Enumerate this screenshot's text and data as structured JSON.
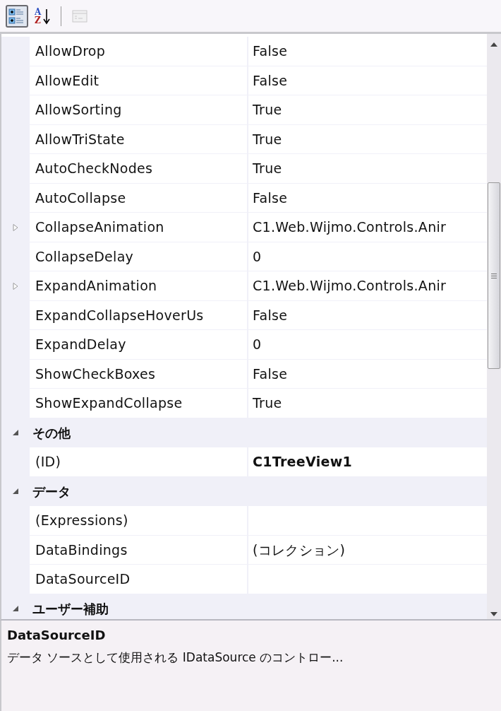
{
  "toolbar": [
    {
      "kind": "categorized",
      "selected": true,
      "disabled": false
    },
    {
      "kind": "alphabetical",
      "selected": false,
      "disabled": false,
      "letters": [
        "A",
        "Z"
      ]
    },
    {
      "kind": "separator"
    },
    {
      "kind": "pages",
      "selected": false,
      "disabled": true
    }
  ],
  "grid": {
    "sections": [
      {
        "properties": [
          {
            "name": "AllowDrop",
            "value": "False",
            "expandable": false,
            "modified": false
          },
          {
            "name": "AllowEdit",
            "value": "False",
            "expandable": false,
            "modified": false
          },
          {
            "name": "AllowSorting",
            "value": "True",
            "expandable": false,
            "modified": false
          },
          {
            "name": "AllowTriState",
            "value": "True",
            "expandable": false,
            "modified": false
          },
          {
            "name": "AutoCheckNodes",
            "value": "True",
            "expandable": false,
            "modified": false
          },
          {
            "name": "AutoCollapse",
            "value": "False",
            "expandable": false,
            "modified": false
          },
          {
            "name": "CollapseAnimation",
            "value": "C1.Web.Wijmo.Controls.Anir",
            "expandable": true,
            "modified": false
          },
          {
            "name": "CollapseDelay",
            "value": "0",
            "expandable": false,
            "modified": false
          },
          {
            "name": "ExpandAnimation",
            "value": "C1.Web.Wijmo.Controls.Anir",
            "expandable": true,
            "modified": false
          },
          {
            "name": "ExpandCollapseHoverUs",
            "value": "False",
            "expandable": false,
            "modified": false
          },
          {
            "name": "ExpandDelay",
            "value": "0",
            "expandable": false,
            "modified": false
          },
          {
            "name": "ShowCheckBoxes",
            "value": "False",
            "expandable": false,
            "modified": false
          },
          {
            "name": "ShowExpandCollapse",
            "value": "True",
            "expandable": false,
            "modified": false
          }
        ]
      },
      {
        "label": "その他",
        "expanded": true,
        "properties": [
          {
            "name": "(ID)",
            "value": "C1TreeView1",
            "expandable": false,
            "modified": true
          }
        ]
      },
      {
        "label": "データ",
        "expanded": true,
        "properties": [
          {
            "name": "(Expressions)",
            "expandable": false
          },
          {
            "name": "DataBindings",
            "value": "(コレクション)",
            "expandable": false,
            "modified": false
          },
          {
            "name": "DataSourceID",
            "expandable": false
          }
        ]
      },
      {
        "label": "ユーザー補助",
        "expanded": true
      }
    ]
  },
  "description": {
    "title": "DataSourceID",
    "text": "データ ソースとして使用される IDataSource のコントロー..."
  }
}
